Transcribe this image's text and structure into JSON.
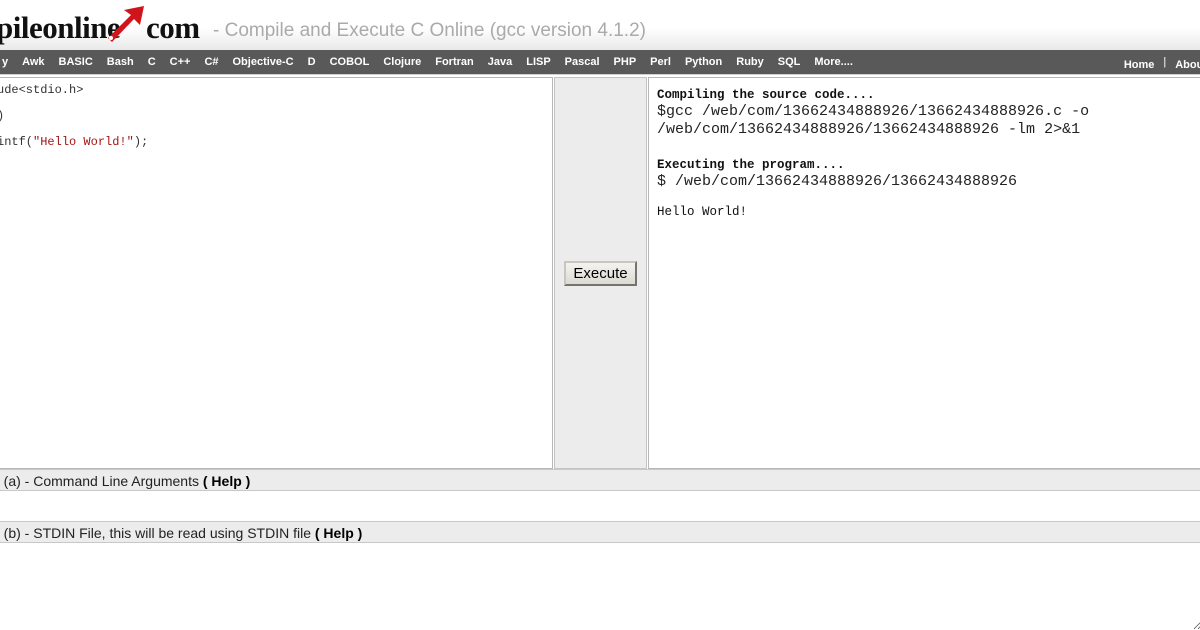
{
  "header": {
    "logo_left": "pileonline",
    "logo_right": "com",
    "tagline": "- Compile and Execute C Online (gcc version 4.1.2)",
    "accent_color": "#d0141c"
  },
  "nav": {
    "languages": [
      "y",
      "Awk",
      "BASIC",
      "Bash",
      "C",
      "C++",
      "C#",
      "Objective-C",
      "D",
      "COBOL",
      "Clojure",
      "Fortran",
      "Java",
      "LISP",
      "Pascal",
      "PHP",
      "Perl",
      "Python",
      "Ruby",
      "SQL",
      "More...."
    ],
    "right_links": [
      "Home",
      "About"
    ],
    "separator": "|"
  },
  "editor": {
    "lines": [
      {
        "text": "ude<stdio.h>"
      },
      {
        "text": ")"
      },
      {
        "prefix": "intf(",
        "string": "\"Hello World!\"",
        "suffix": ");"
      }
    ]
  },
  "execute": {
    "button_label": "Execute"
  },
  "output": {
    "compile_heading": "Compiling the source code....",
    "compile_cmd_1": "$gcc /web/com/13662434888926/13662434888926.c -o",
    "compile_cmd_2": "/web/com/13662434888926/13662434888926 -lm 2>&1",
    "exec_heading": "Executing the program....",
    "exec_cmd": "$ /web/com/13662434888926/13662434888926",
    "program_output": "Hello World!"
  },
  "options": {
    "args_label": "n (a) - Command Line Arguments",
    "stdin_label": "n (b) - STDIN File, this will be read using STDIN file",
    "help_label": "( Help )"
  }
}
